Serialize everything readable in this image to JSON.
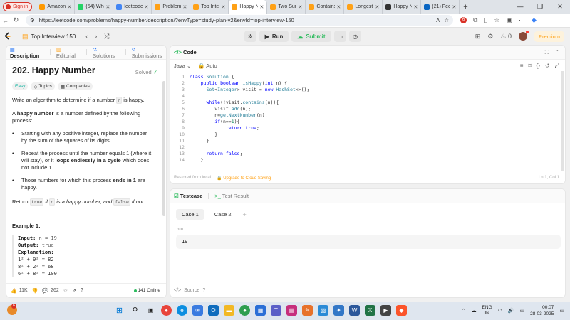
{
  "browser": {
    "signin_label": "Sign in",
    "tabs": [
      {
        "label": "Amazon",
        "color": "#ff9900",
        "active": false
      },
      {
        "label": "(54) WhatsApp",
        "color": "#25d366",
        "active": false
      },
      {
        "label": "leetcode",
        "color": "#4285f4",
        "active": false
      },
      {
        "label": "Problems",
        "color": "#ffa116",
        "active": false
      },
      {
        "label": "Top Interview",
        "color": "#ffa116",
        "active": false
      },
      {
        "label": "Happy Number",
        "color": "#ffa116",
        "active": true
      },
      {
        "label": "Two Sum",
        "color": "#ffa116",
        "active": false
      },
      {
        "label": "Contains",
        "color": "#ffa116",
        "active": false
      },
      {
        "label": "Longest",
        "color": "#ffa116",
        "active": false
      },
      {
        "label": "Happy Number",
        "color": "#333333",
        "active": false
      },
      {
        "label": "(21) Feed",
        "color": "#0a66c2",
        "active": false
      }
    ],
    "url": "https://leetcode.com/problems/happy-number/description/?envType=study-plan-v2&envId=top-interview-150",
    "notification_count": "6"
  },
  "header": {
    "problem_list": "Top Interview 150",
    "run_label": "Run",
    "submit_label": "Submit",
    "streak": "0",
    "premium_label": "Premium"
  },
  "left_panel": {
    "tabs": [
      "Description",
      "Editorial",
      "Solutions",
      "Submissions"
    ],
    "title": "202. Happy Number",
    "status": "Solved",
    "chips": [
      "Easy",
      "Topics",
      "Companies"
    ],
    "intro": "Write an algorithm to determine if a number",
    "intro_code": "n",
    "intro_end": "is happy.",
    "def_bold": "happy number",
    "def_pre": "A",
    "def_post": "is a number defined by the following process:",
    "bullets": [
      "Starting with any positive integer, replace the number by the sum of the squares of its digits.",
      "Repeat the process until the number equals 1 (where it will stay), or it",
      "Those numbers for which this process"
    ],
    "bullet2_bold": "loops endlessly in a cycle",
    "bullet2_end": "which does not include 1.",
    "bullet3_bold": "ends in 1",
    "bullet3_end": "are happy.",
    "return_pre": "Return",
    "return_true": "true",
    "return_if": "if",
    "return_n": "n",
    "return_mid": "is a happy number, and",
    "return_false": "false",
    "return_end": "if not.",
    "example_heading": "Example 1:",
    "example": {
      "input_k": "Input:",
      "input_v": "n = 19",
      "output_k": "Output:",
      "output_v": "true",
      "expl_k": "Explanation:",
      "lines": [
        "1² + 9² = 82",
        "8² + 2² = 68",
        "6² + 8² = 100"
      ]
    },
    "likes": "11K",
    "comments": "262",
    "online": "141 Online"
  },
  "code_panel": {
    "title": "Code",
    "language": "Java",
    "mode": "Auto",
    "line_numbers": [
      "1",
      "2",
      "3",
      "4",
      "5",
      "6",
      "7",
      "8",
      "9",
      "10",
      "11",
      "12",
      "13",
      "14"
    ],
    "footer_saved": "Restored from local",
    "footer_upgrade": "Upgrade to Cloud Saving",
    "cursor": "Ln 1, Col 1"
  },
  "test_panel": {
    "tab_testcase": "Testcase",
    "tab_result": "Test Result",
    "cases": [
      "Case 1",
      "Case 2"
    ],
    "input_label": "n =",
    "input_value": "19",
    "source_label": "Source"
  },
  "taskbar": {
    "weather_badge": "6",
    "lang_top": "ENG",
    "lang_bottom": "IN",
    "time": "00:07",
    "date": "28-03-2025"
  }
}
